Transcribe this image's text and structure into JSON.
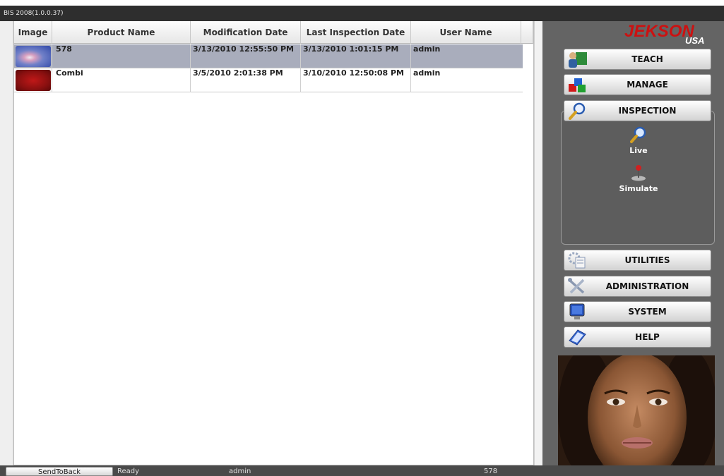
{
  "window": {
    "title": "BIS 2008(1.0.0.37)"
  },
  "table": {
    "columns": [
      "Image",
      "Product Name",
      "Modification Date",
      "Last Inspection Date",
      "User Name"
    ],
    "rows": [
      {
        "product_name": "578",
        "modification_date": "3/13/2010 12:55:50 PM",
        "last_inspection_date": "3/13/2010 1:01:15 PM",
        "user_name": "admin",
        "selected": true,
        "thumb_color": "#5a6fb8"
      },
      {
        "product_name": "Combi",
        "modification_date": "3/5/2010 2:01:38 PM",
        "last_inspection_date": "3/10/2010 12:50:08 PM",
        "user_name": "admin",
        "selected": false,
        "thumb_color": "#a01818"
      }
    ]
  },
  "brand": {
    "logo_main": "JEKSON",
    "logo_sub": "USA",
    "logo_color": "#cc1111"
  },
  "nav": {
    "teach": "TEACH",
    "manage": "MANAGE",
    "inspection": "INSPECTION",
    "inspection_items": [
      "Live",
      "Simulate"
    ],
    "utilities": "UTILITIES",
    "administration": "ADMINISTRATION",
    "system": "SYSTEM",
    "help": "HELP"
  },
  "statusbar": {
    "send_to_back": "SendToBack",
    "status": "Ready",
    "user": "admin",
    "product": "578"
  },
  "colors": {
    "panel_bg": "#646464",
    "selected_row": "#a9adbc",
    "titlebar": "#2e2e2e"
  }
}
